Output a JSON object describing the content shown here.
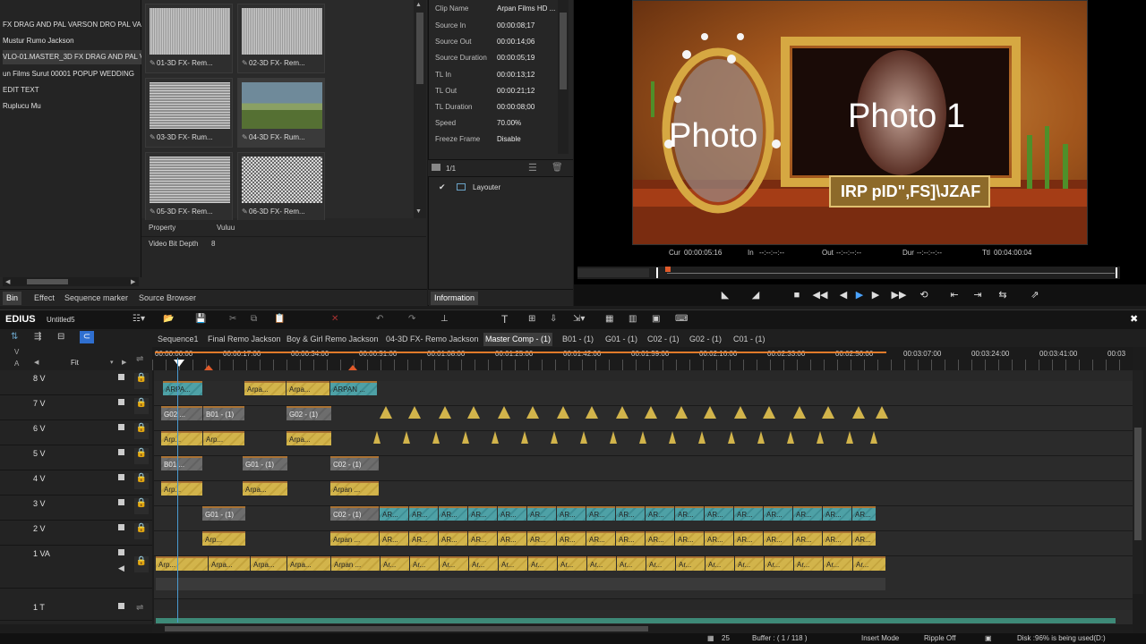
{
  "bin": {
    "folders": [
      "FX DRAG AND PAL VARSON DRO PAL VAR",
      "Mustur Rumo Jackson",
      "VLO-01.MASTER_3D FX DRAG AND PAL V",
      "un Films Surut 00001 POPUP WEDDING",
      "EDIT TEXT",
      "Ruplucu Mu"
    ],
    "clips": [
      {
        "name": "01-3D FX- Rem...",
        "thumb": "t-stripe"
      },
      {
        "name": "02-3D FX- Rem...",
        "thumb": "t-stripe"
      },
      {
        "name": "03-3D FX- Rum...",
        "thumb": "t-stripe2"
      },
      {
        "name": "04-3D FX- Rum...",
        "thumb": "t-land"
      },
      {
        "name": "05-3D FX- Rem...",
        "thumb": "t-stripe2"
      },
      {
        "name": "06-3D FX- Rem...",
        "thumb": "t-check"
      }
    ],
    "property_header": {
      "property": "Property",
      "value": "Vuluu"
    },
    "property_rows": [
      {
        "k": "Video Bit Depth",
        "v": "8"
      }
    ],
    "tabs": [
      "Bin",
      "Effect",
      "Sequence marker",
      "Source Browser"
    ]
  },
  "info": {
    "rows": [
      {
        "k": "Clip Name",
        "v": "Arpan Films HD ..."
      },
      {
        "k": "Source In",
        "v": "00:00:08;17"
      },
      {
        "k": "Source Out",
        "v": "00:00:14;06"
      },
      {
        "k": "Source Duration",
        "v": "00:00:05;19"
      },
      {
        "k": "TL In",
        "v": "00:00:13;12"
      },
      {
        "k": "TL Out",
        "v": "00:00:21;12"
      },
      {
        "k": "TL Duration",
        "v": "00:00:08;00"
      },
      {
        "k": "Speed",
        "v": "70.00%"
      },
      {
        "k": "Freeze Frame",
        "v": "Disable"
      }
    ],
    "layer_count": "1/1",
    "layer_name": "Layouter",
    "tab": "Information"
  },
  "preview": {
    "text_left": "Photo",
    "text_right": "Photo 1",
    "banner": "IRP pID\",FS]\\JZAF",
    "cur": "Cur",
    "cur_val": "00:00:05:16",
    "in": "In",
    "in_val": "--:--:--:--",
    "out": "Out",
    "out_val": "--:--:--:--",
    "dur": "Dur",
    "dur_val": "--:--:--:--",
    "ttl": "Ttl",
    "ttl_val": "00:04:00:04"
  },
  "timeline": {
    "app": "EDIUS",
    "project": "Untitled5",
    "fit": "Fit",
    "seq_tabs": [
      "Sequence1",
      "Final Remo Jackson",
      "Boy & Girl Remo Jackson",
      "04-3D FX- Remo Jackson",
      "Master Comp - (1)",
      "B01 - (1)",
      "G01 - (1)",
      "C02 - (1)",
      "G02 - (1)",
      "C01 - (1)"
    ],
    "active_seq": 4,
    "ruler": [
      "00:00:00:00",
      "00:00:17:00",
      "00:00:34:00",
      "00:00:51:00",
      "00:01:08:00",
      "00:01:25:00",
      "00:01:42:00",
      "00:01:59:00",
      "00:02:16:00",
      "00:02:33:00",
      "00:02:50:00",
      "00:03:07:00",
      "00:03:24:00",
      "00:03:41:00",
      "00:03"
    ],
    "tracks": [
      "8 V",
      "7 V",
      "6 V",
      "5 V",
      "4 V",
      "3 V",
      "2 V",
      "1 VA",
      "1 T"
    ],
    "clip_labels": {
      "arpa": "ARPA...",
      "arpa2": "Arpa...",
      "arpan": "ARPAN ...",
      "g02": "G02 ...",
      "b01": "B01 - (1)",
      "g02b": "G02 - (1)",
      "arp": "Arp...",
      "b01b": "B01 ...",
      "g01": "G01 - (1)",
      "c02": "C02 - (1)",
      "arpana": "Arpan ...",
      "arpa3": "Arpa...",
      "ar": "AR...",
      "arv": "Ar..."
    }
  },
  "status": {
    "frames": "25",
    "buffer": "Buffer : ( 1 / 118 )",
    "mode": "Insert Mode",
    "ripple": "Ripple Off",
    "disk": "Disk :96% is being used(D:)"
  }
}
